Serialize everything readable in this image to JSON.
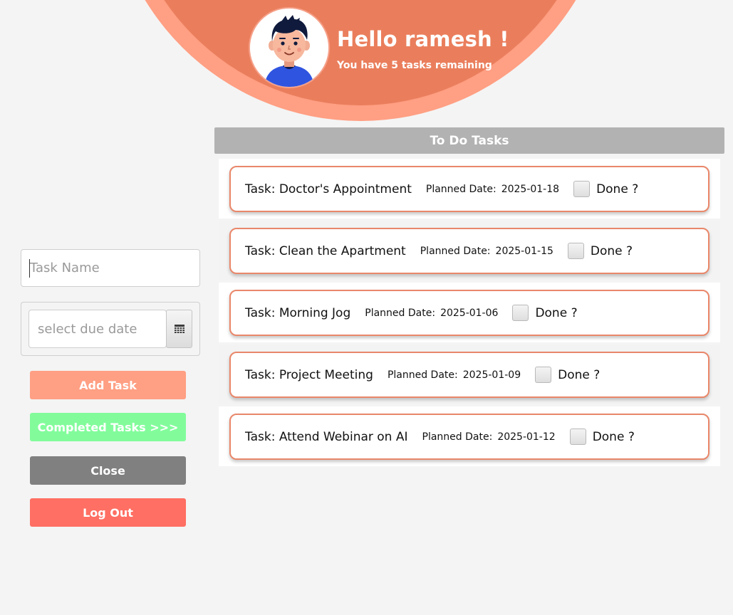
{
  "header": {
    "greeting": "Hello ramesh !",
    "remaining": "You have 5 tasks remaining"
  },
  "form": {
    "task_name_placeholder": "Task Name",
    "due_date_placeholder": "select due date"
  },
  "buttons": {
    "add_task": "Add Task",
    "completed_tasks": "Completed Tasks >>>",
    "close": "Close",
    "log_out": "Log Out"
  },
  "task_list": {
    "title": "To Do Tasks",
    "planned_label": "Planned Date:",
    "done_label": "Done ?",
    "tasks": [
      {
        "name": "Task: Doctor's Appointment",
        "date": "2025-01-18",
        "done": false
      },
      {
        "name": "Task: Clean the Apartment",
        "date": "2025-01-15",
        "done": false
      },
      {
        "name": "Task: Morning Jog",
        "date": "2025-01-06",
        "done": false
      },
      {
        "name": "Task: Project Meeting",
        "date": "2025-01-09",
        "done": false
      },
      {
        "name": "Task: Attend Webinar on AI",
        "date": "2025-01-12",
        "done": false
      }
    ]
  },
  "colors": {
    "arc_outer": "#ff9f83",
    "arc_inner": "#ea7e5c",
    "card_border": "#e9876a",
    "add_button": "#ff9f83",
    "completed_button": "#82fc9b",
    "close_button": "#808080",
    "logout_button": "#ff6f63",
    "list_header": "#b2b2b2"
  },
  "icons": {
    "avatar": "user-avatar-icon",
    "calendar": "calendar-icon"
  }
}
